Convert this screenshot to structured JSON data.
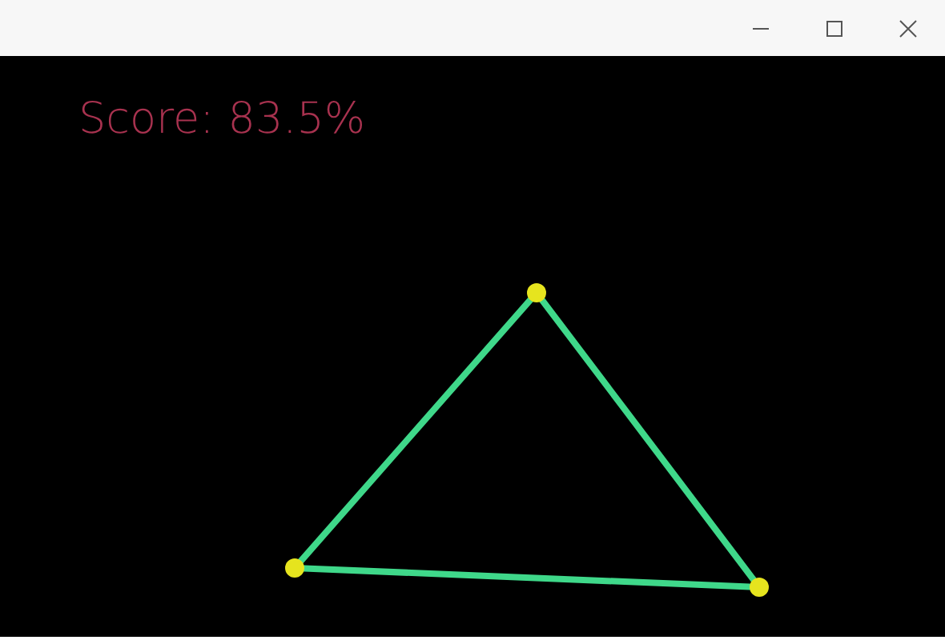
{
  "window": {
    "controls": [
      {
        "kind": "minimize"
      },
      {
        "kind": "maximize"
      },
      {
        "kind": "close"
      }
    ]
  },
  "canvas": {
    "score": "Score: 83.5%"
  }
}
